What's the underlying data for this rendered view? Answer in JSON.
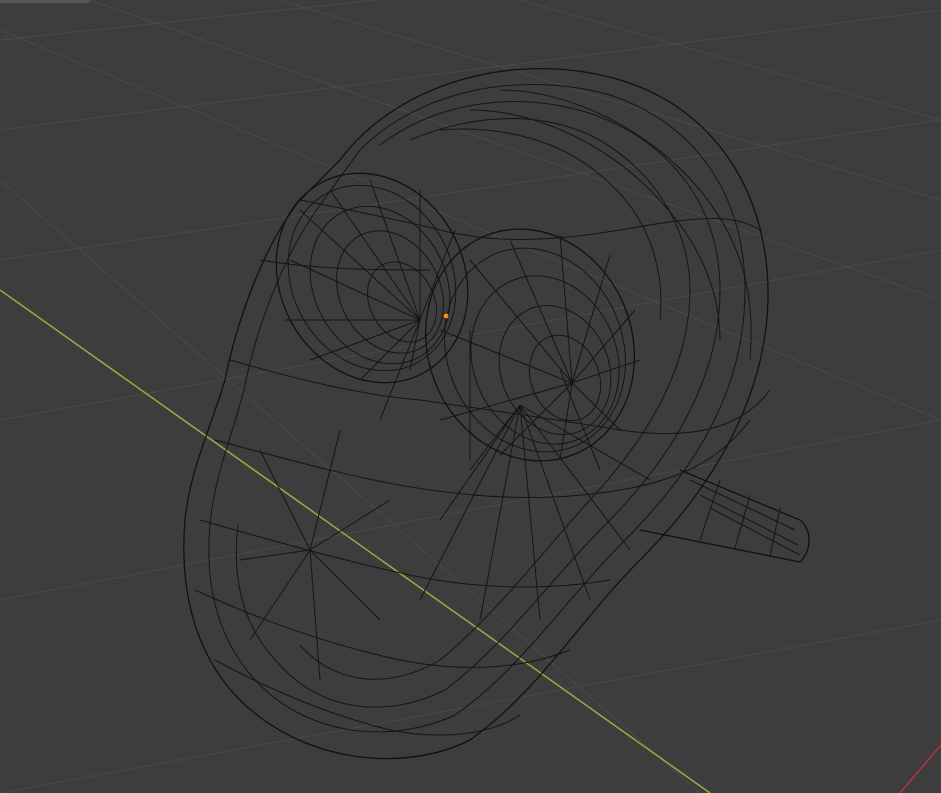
{
  "app": "3D Viewport",
  "view": {
    "shading": "wireframe",
    "object": "head-mesh",
    "colors": {
      "background": "#3d3d3d",
      "grid": "#4a4a4a",
      "x_axis": "#8eb33b",
      "y_axis": "#b8323c",
      "wire": "#151515",
      "origin": "#ff8c1a"
    }
  }
}
